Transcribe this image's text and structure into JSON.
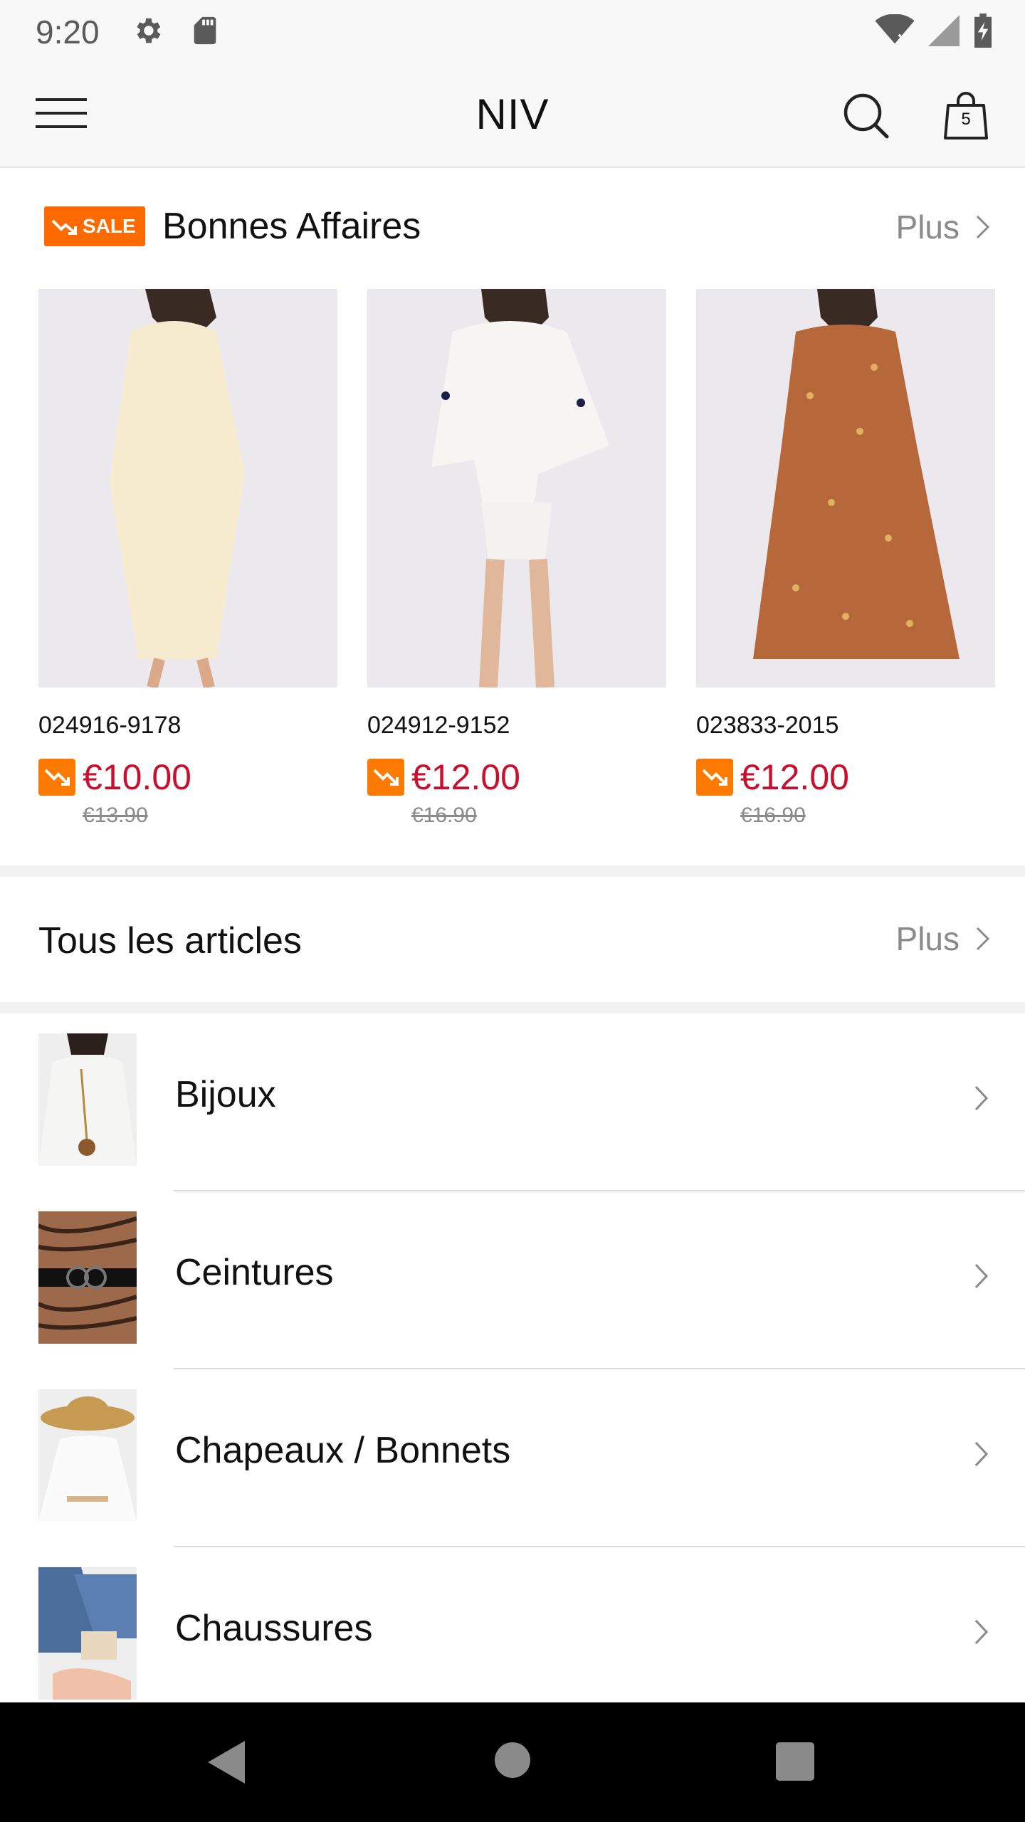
{
  "status_bar": {
    "time": "9:20",
    "icons": [
      "gear-icon",
      "sd-card-icon",
      "wifi-icon",
      "signal-icon",
      "battery-icon"
    ]
  },
  "app_bar": {
    "title": "NIV",
    "cart_count": "5",
    "icons": [
      "menu-icon",
      "search-icon",
      "shopping-bag-icon"
    ]
  },
  "sale_section": {
    "badge": "SALE",
    "title": "Bonnes Affaires",
    "more_label": "Plus",
    "products": [
      {
        "sku": "024916-9178",
        "price": "€10.00",
        "old_price": "€13.90"
      },
      {
        "sku": "024912-9152",
        "price": "€12.00",
        "old_price": "€16.90"
      },
      {
        "sku": "023833-2015",
        "price": "€12.00",
        "old_price": "€16.90"
      }
    ]
  },
  "articles_section": {
    "title": "Tous les articles",
    "more_label": "Plus",
    "categories": [
      {
        "label": "Bijoux"
      },
      {
        "label": "Ceintures"
      },
      {
        "label": "Chapeaux / Bonnets"
      },
      {
        "label": "Chaussures"
      }
    ]
  },
  "colors": {
    "accent_orange": "#ff6a00",
    "price_red": "#c8102e",
    "muted_gray": "#8a8a8a"
  },
  "nav_bar": {
    "icons": [
      "back-icon",
      "home-icon",
      "recents-icon"
    ]
  }
}
